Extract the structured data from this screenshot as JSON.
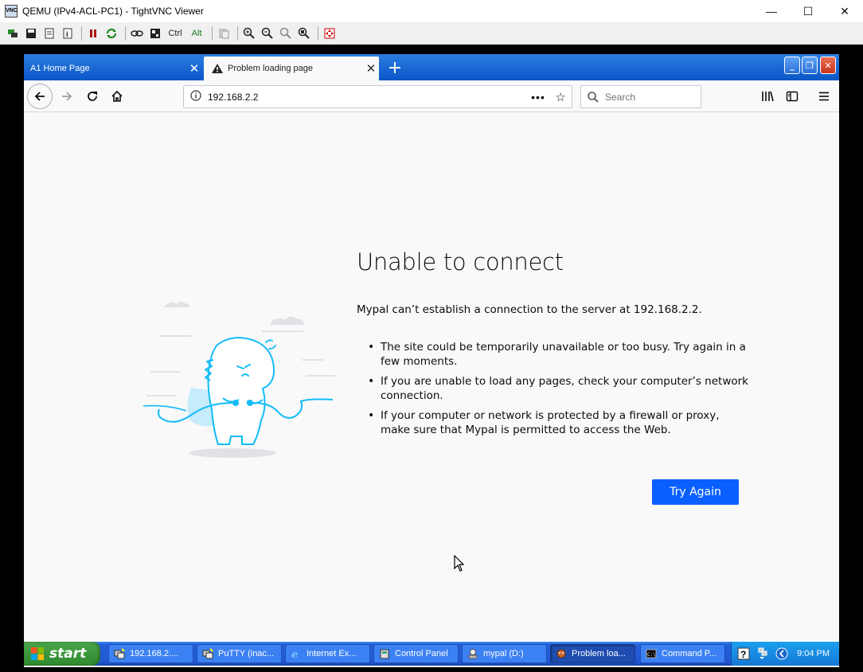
{
  "vnc": {
    "title": "QEMU (IPv4-ACL-PC1) - TightVNC Viewer",
    "app_icon": "VNC",
    "toolbar": {
      "ctrl_label": "Ctrl",
      "alt_label": "Alt"
    }
  },
  "browser": {
    "tabs": [
      {
        "label": "A1 Home Page",
        "active": false
      },
      {
        "label": "Problem loading page",
        "active": true
      }
    ],
    "url": "192.168.2.2",
    "search_placeholder": "Search"
  },
  "error_page": {
    "title": "Unable to connect",
    "description": "Mypal can’t establish a connection to the server at 192.168.2.2.",
    "tips": [
      "The site could be temporarily unavailable or too busy. Try again in a few moments.",
      "If you are unable to load any pages, check your computer’s network connection.",
      "If your computer or network is protected by a firewall or proxy, make sure that Mypal is permitted to access the Web."
    ],
    "try_again_label": "Try Again"
  },
  "taskbar": {
    "start_label": "start",
    "tasks": [
      {
        "label": "192.168.2....",
        "icon": "putty-icon"
      },
      {
        "label": "PuTTY (inac...",
        "icon": "putty-icon"
      },
      {
        "label": "Internet Ex...",
        "icon": "ie-icon"
      },
      {
        "label": "Control Panel",
        "icon": "control-panel-icon"
      },
      {
        "label": "mypal (D:)",
        "icon": "drive-icon"
      },
      {
        "label": "Problem loa...",
        "icon": "mypal-icon",
        "active": true
      },
      {
        "label": "Command P...",
        "icon": "cmd-icon"
      }
    ],
    "clock": "9:04 PM"
  },
  "colors": {
    "accent": "#0a60ff",
    "tabstrip": "#0b57c9",
    "taskbar": "#2157d3",
    "illustration": "#12bcf7"
  }
}
